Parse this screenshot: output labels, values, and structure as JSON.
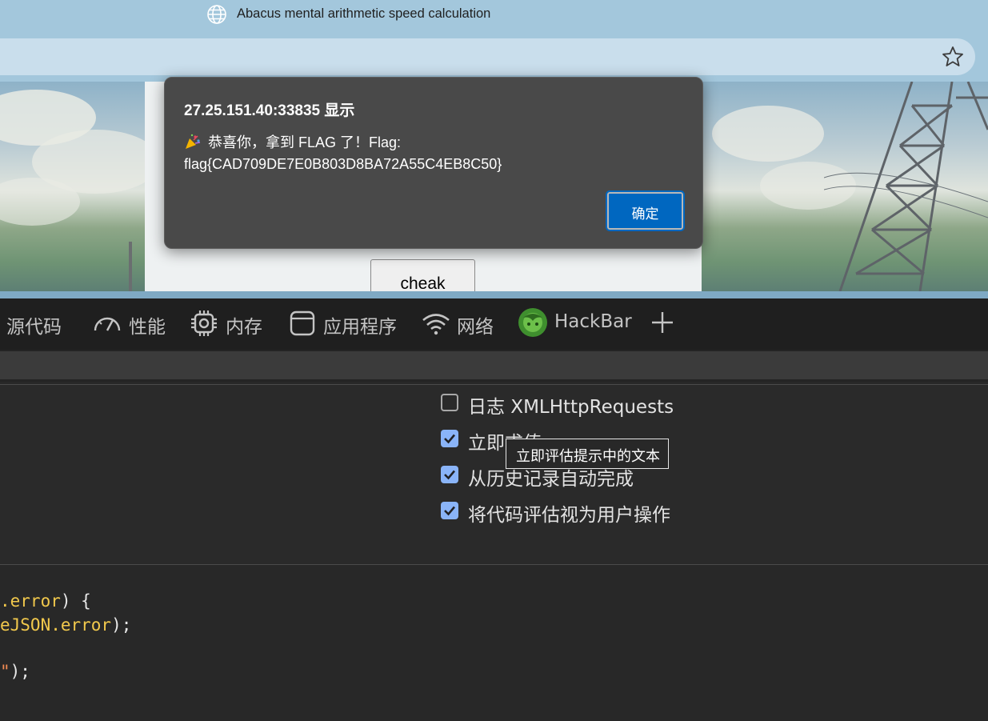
{
  "browser": {
    "tab_title": "Abacus mental arithmetic speed calculation"
  },
  "page": {
    "check_button_label": "cheak"
  },
  "dialog": {
    "origin_title": "27.25.151.40:33835 显示",
    "message_line1": "恭喜你，拿到 FLAG 了！Flag:",
    "message_line2": "flag{CAD709DE7E0B803D8BA72A55C4EB8C50}",
    "ok_label": "确定"
  },
  "devtools": {
    "tabs": [
      {
        "label": "源代码",
        "icon": "sources-icon"
      },
      {
        "label": "性能",
        "icon": "performance-gauge-icon"
      },
      {
        "label": "内存",
        "icon": "memory-chip-icon"
      },
      {
        "label": "应用程序",
        "icon": "application-window-icon"
      },
      {
        "label": "网络",
        "icon": "wifi-network-icon"
      },
      {
        "label": "HackBar",
        "icon": "hackbar-logo-icon"
      }
    ],
    "add_tab_icon": "plus-icon",
    "console_settings": [
      {
        "label": "日志 XMLHttpRequests",
        "checked": false
      },
      {
        "label": "立即求值",
        "checked": true
      },
      {
        "label": "从历史记录自动完成",
        "checked": true
      },
      {
        "label": "将代码评估视为用户操作",
        "checked": true
      }
    ],
    "tooltip": "立即评估提示中的文本",
    "code_lines": {
      "line1_prop": ".error",
      "line1_rest": ") {",
      "line2_prop": "eJSON.error",
      "line2_rest": ");",
      "line3_str": "\"",
      "line3_rest": ");"
    }
  }
}
